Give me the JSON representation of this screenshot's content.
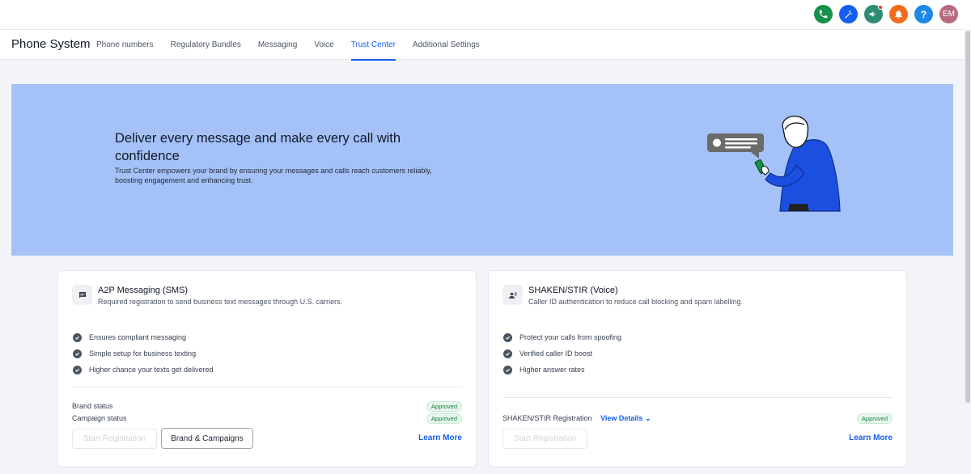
{
  "topbar": {
    "icons": [
      {
        "name": "phone-icon",
        "color": "#17914a"
      },
      {
        "name": "magic-wand-icon",
        "color": "#155eef"
      },
      {
        "name": "megaphone-icon",
        "color": "#2e8b74"
      },
      {
        "name": "bell-icon",
        "color": "#f26b1d"
      },
      {
        "name": "help-icon",
        "color": "#1e88e5"
      }
    ],
    "avatar_initials": "EM",
    "avatar_color": "#b86b7c"
  },
  "subnav": {
    "title": "Phone System",
    "tabs": [
      {
        "label": "Phone numbers",
        "active": false
      },
      {
        "label": "Regulatory Bundles",
        "active": false
      },
      {
        "label": "Messaging",
        "active": false
      },
      {
        "label": "Voice",
        "active": false
      },
      {
        "label": "Trust Center",
        "active": true
      },
      {
        "label": "Additional Settings",
        "active": false
      }
    ]
  },
  "hero": {
    "headline": "Deliver every message and make every call with confidence",
    "body": "Trust Center empowers your brand by ensuring your messages and calls reach customers reliably, boosting engagement and enhancing trust.",
    "background": "#a4c2f8"
  },
  "cards": {
    "a2p": {
      "icon": "chat-icon",
      "title": "A2P Messaging (SMS)",
      "subtitle": "Required registration to send business text messages through U.S. carriers.",
      "features": [
        "Ensures compliant messaging",
        "Simple setup for business texting",
        "Higher chance your texts get delivered"
      ],
      "brand_status_label": "Brand status",
      "brand_status_value": "Approved",
      "campaign_status_label": "Campaign status",
      "campaign_status_value": "Approved",
      "start_button": "Start Registration",
      "brand_button": "Brand & Campaigns",
      "learn_more": "Learn More"
    },
    "shaken": {
      "icon": "voice-person-icon",
      "title": "SHAKEN/STIR (Voice)",
      "subtitle": "Caller ID authentication to reduce call blocking and spam labelling.",
      "features": [
        "Protect your calls from spoofing",
        "Verified caller ID boost",
        "Higher answer rates"
      ],
      "registration_label": "SHAKEN/STIR Registration",
      "view_details": "View Details",
      "registration_value": "Approved",
      "start_button": "Start Registration",
      "learn_more": "Learn More"
    }
  },
  "colors": {
    "accent": "#155eef",
    "approved_text": "#16803c",
    "approved_bg": "#e7f6ec"
  }
}
